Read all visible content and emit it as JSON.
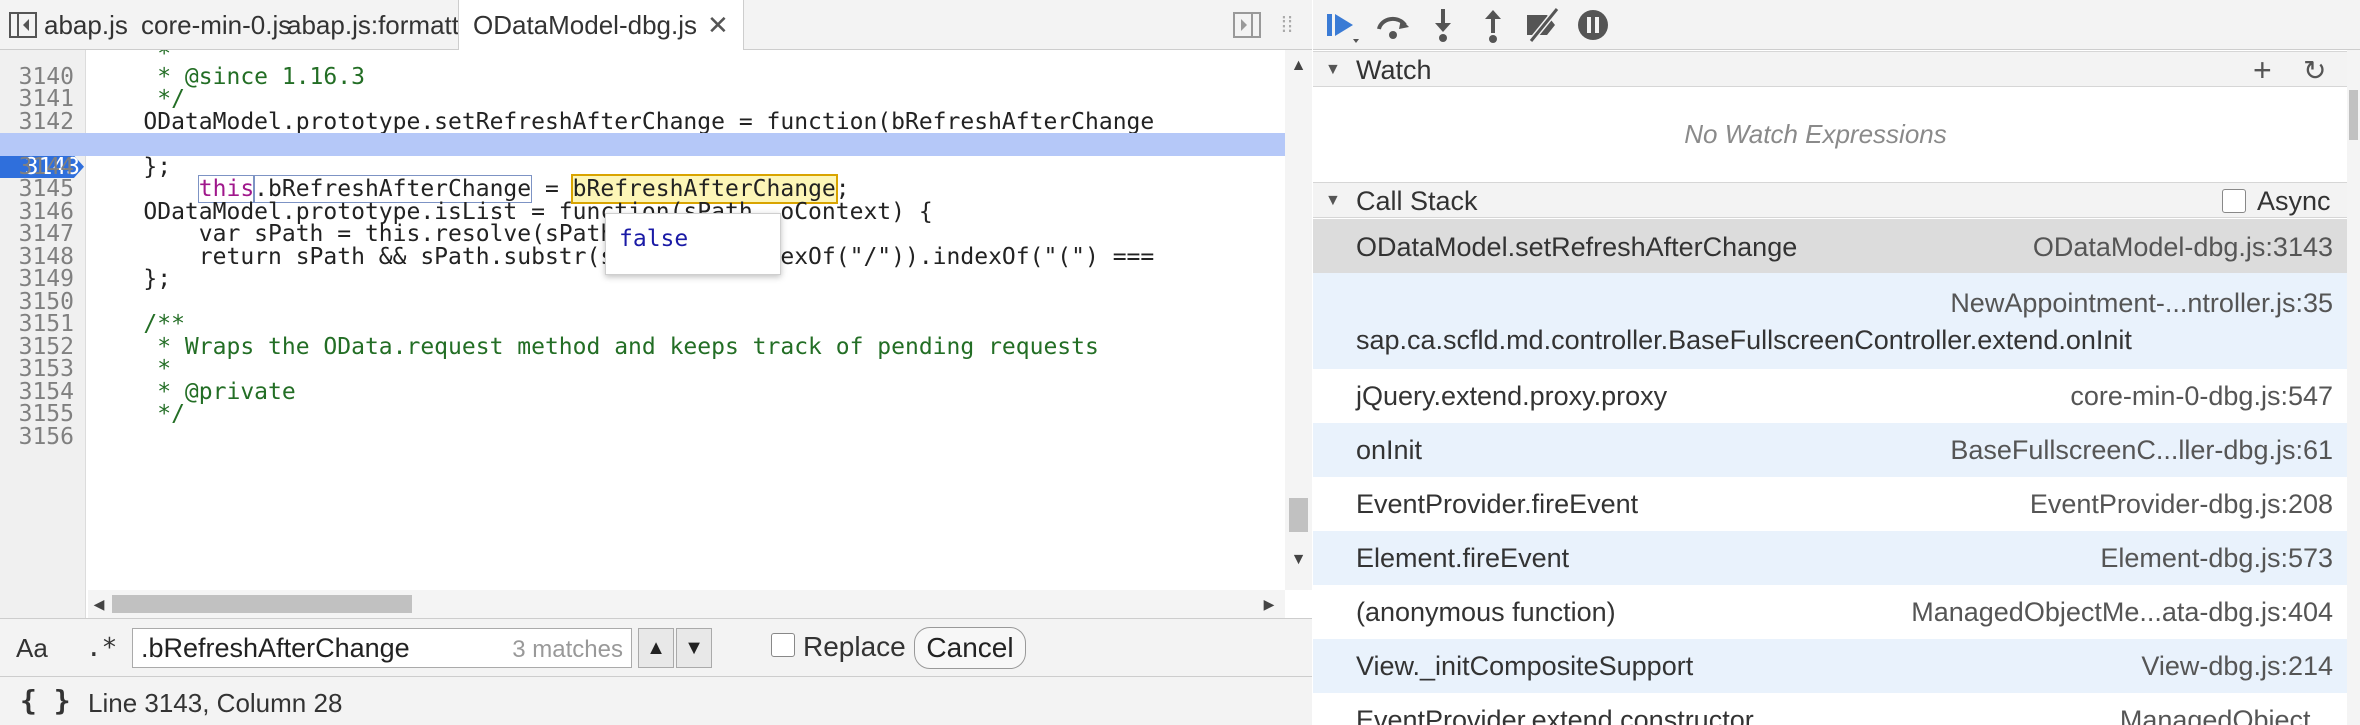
{
  "tabs": [
    {
      "label": "abap.js"
    },
    {
      "label": "core-min-0.js"
    },
    {
      "label": "abap.js:formatted"
    },
    {
      "label": "ODataModel-dbg.js",
      "active": true
    }
  ],
  "tab_close_glyph": "✕",
  "code": {
    "exec_line": 3143,
    "lines": [
      {
        "n": "3140",
        "t": "     * @since 1.16.3"
      },
      {
        "n": "3141",
        "t": "     */"
      },
      {
        "n": "3142",
        "t": "    ODataModel.prototype.setRefreshAfterChange = function(bRefreshAfterChange"
      },
      {
        "n": "3143",
        "t": "        this.bRefreshAfterChange = bRefreshAfterChange;"
      },
      {
        "n": "3144",
        "t": "    };"
      },
      {
        "n": "3145",
        "t": ""
      },
      {
        "n": "3146",
        "t": "    ODataModel.prototype.isList = function(sPath, oContext) {"
      },
      {
        "n": "3147",
        "t": "        var sPath = this.resolve(sPath, oContext);"
      },
      {
        "n": "3148",
        "t": "        return sPath && sPath.substr(sPath.lastIndexOf(\"/\")).indexOf(\"(\") ==="
      },
      {
        "n": "3149",
        "t": "    };"
      },
      {
        "n": "3150",
        "t": ""
      },
      {
        "n": "3151",
        "t": "    /**"
      },
      {
        "n": "3152",
        "t": "     * Wraps the OData.request method and keeps track of pending requests"
      },
      {
        "n": "3153",
        "t": "     *"
      },
      {
        "n": "3154",
        "t": "     * @private"
      },
      {
        "n": "3155",
        "t": "     */"
      },
      {
        "n": "3156",
        "t": ""
      }
    ]
  },
  "tooltip": {
    "value": "false"
  },
  "search": {
    "case_label": "Aa",
    "regex_label": ".*",
    "query": ".bRefreshAfterChange",
    "match_count": "3 matches",
    "replace_label": "Replace",
    "cancel_label": "Cancel"
  },
  "status": {
    "pretty_print_label": "{ }",
    "cursor": "Line 3143, Column 28"
  },
  "watch": {
    "title": "Watch",
    "empty_text": "No Watch Expressions"
  },
  "call_stack": {
    "title": "Call Stack",
    "async_label": "Async",
    "frames": [
      {
        "fn": "ODataModel.setRefreshAfterChange",
        "loc": "ODataModel-dbg.js:3143"
      },
      {
        "fn": "sap.ca.scfld.md.controller.BaseFullscreenController.extend.onInit",
        "loc": "NewAppointment-...ntroller.js:35"
      },
      {
        "fn": "jQuery.extend.proxy.proxy",
        "loc": "core-min-0-dbg.js:547"
      },
      {
        "fn": "onInit",
        "loc": "BaseFullscreenC...ller-dbg.js:61"
      },
      {
        "fn": "EventProvider.fireEvent",
        "loc": "EventProvider-dbg.js:208"
      },
      {
        "fn": "Element.fireEvent",
        "loc": "Element-dbg.js:573"
      },
      {
        "fn": "(anonymous function)",
        "loc": "ManagedObjectMe...ata-dbg.js:404"
      },
      {
        "fn": "View._initCompositeSupport",
        "loc": "View-dbg.js:214"
      },
      {
        "fn": "EventProvider.extend.constructor",
        "loc": "ManagedObject..."
      }
    ]
  },
  "colors": {
    "exec_line_bg": "#b5c8f8",
    "exec_marker": "#2f6fdc",
    "selected_frame_bg": "#dcdcdc",
    "alt_frame_bg": "#e9f2fc",
    "debugger_accent": "#3a7bd5"
  }
}
